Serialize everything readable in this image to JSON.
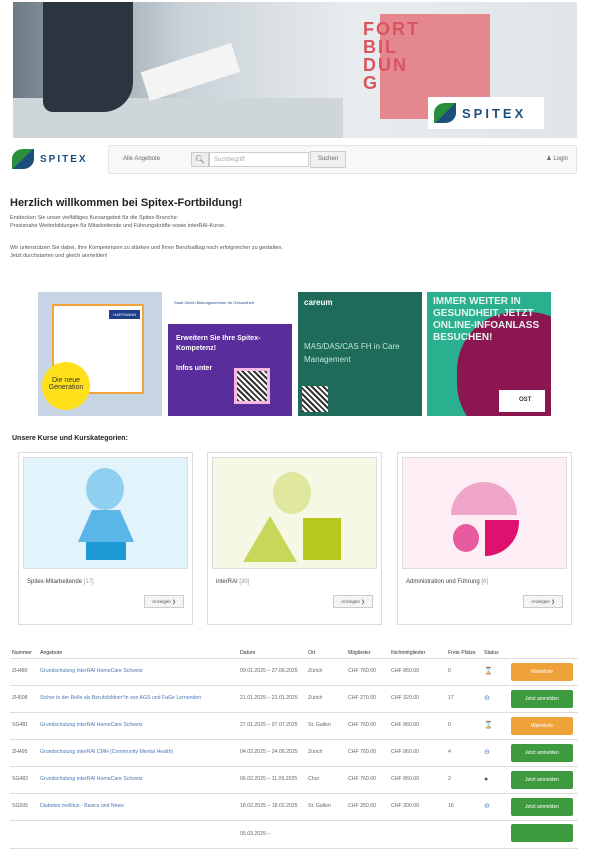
{
  "banner": {
    "text": "FORT\nBIL\nDUN\nG",
    "logo": "SPITEX"
  },
  "header": {
    "logo": "SPITEX",
    "all_offers": "Alle Angebote",
    "search_placeholder": "Suchbegriff",
    "search_button": "Suchen",
    "login": "Login"
  },
  "welcome": {
    "title": "Herzlich willkommen bei Spitex-Fortbildung!",
    "p1": "Entdecken Sie unser vielfältiges Kursangebot für die Spitex-Branche:",
    "p2": "Praxisnahe Weiterbildungen für Mitarbeitende und Führungskräfte sowie interRAI-Kurse.",
    "p3": "Wir unterstützen Sie dabei, Ihre Kompetenzen zu stärken und Ihren Berufsalltag noch erfolgreicher zu gestalten.",
    "p4": "Jetzt durchstarten und gleich anmelden!"
  },
  "ads": [
    {
      "badge": "Die neue Generation",
      "brand": "HARTMANN"
    },
    {
      "header": "Stadt Zürich Bildungszentrum für Gesundheit",
      "text": "Erweitern Sie Ihre Spitex-Kompetenz!",
      "sub": "Infos unter"
    },
    {
      "brand": "careum",
      "text": "MAS/DAS/CAS FH in Care Management"
    },
    {
      "text": "IMMER WEITER IN GESUNDHEIT, JETZT ONLINE-INFOANLASS BESUCHEN!",
      "brand": "OST"
    }
  ],
  "categories": {
    "title": "Unsere Kurse und Kurskategorien:",
    "items": [
      {
        "name": "Spitex-Mitarbeitende",
        "count": "[17]",
        "button": "Anzeigen"
      },
      {
        "name": "interRAI",
        "count": "[30]",
        "button": "Anzeigen"
      },
      {
        "name": "Administration und Führung",
        "count": "[6]",
        "button": "Anzeigen"
      }
    ]
  },
  "table": {
    "headers": [
      "Nummer",
      "Angebote",
      "Datum",
      "Ort",
      "Mitglieder",
      "Nichtmitglieder",
      "Freie Plätze",
      "Status",
      ""
    ],
    "rows": [
      {
        "nr": "ZH480",
        "title": "Grundschulung interRAI HomeCare Schweiz",
        "date": "09.01.2025 – 27.06.2025",
        "ort": "Zürich",
        "mit": "CHF 760.00",
        "nicht": "CHF 860.00",
        "plaetze": "0",
        "status": "⌛",
        "button": "Warteliste",
        "type": "wait"
      },
      {
        "nr": "ZH508",
        "title": "Sicher in der Rolle als Berufsbildner*in von AGS und FaGe Lernenden",
        "date": "21.01.2025 – 21.01.2025",
        "ort": "Zürich",
        "mit": "CHF 270.00",
        "nicht": "CHF 320.00",
        "plaetze": "17",
        "status": "⊖",
        "button": "Jetzt anmelden",
        "type": "reg"
      },
      {
        "nr": "SG481",
        "title": "Grundschulung interRAI HomeCare Schweiz",
        "date": "27.01.2025 – 07.07.2025",
        "ort": "St. Gallen",
        "mit": "CHF 760.00",
        "nicht": "CHF 860.00",
        "plaetze": "0",
        "status": "⌛",
        "button": "Warteliste",
        "type": "wait"
      },
      {
        "nr": "ZH495",
        "title": "Grundschulung interRAI CMH (Community Mental Health)",
        "date": "04.02.2025 – 24.06.2025",
        "ort": "Zürich",
        "mit": "CHF 760.00",
        "nicht": "CHF 860.00",
        "plaetze": "4",
        "status": "⊖",
        "button": "Jetzt anmelden",
        "type": "reg"
      },
      {
        "nr": "SG482",
        "title": "Grundschulung interRAI HomeCare Schweiz",
        "date": "06.02.2025 – 11.09.2025",
        "ort": "Chur",
        "mit": "CHF 760.00",
        "nicht": "CHF 860.00",
        "plaetze": "2",
        "status": "●",
        "button": "Jetzt anmelden",
        "type": "reg"
      },
      {
        "nr": "SG505",
        "title": "Diabetes mellitus - Basics und News",
        "date": "18.02.2025 – 18.02.2025",
        "ort": "St. Gallen",
        "mit": "CHF 250.00",
        "nicht": "CHF 300.00",
        "plaetze": "16",
        "status": "⊖",
        "button": "Jetzt anmelden",
        "type": "reg"
      },
      {
        "nr": "",
        "title": "",
        "date": "05.03.2025 –",
        "ort": "",
        "mit": "",
        "nicht": "",
        "plaetze": "",
        "status": "",
        "button": "",
        "type": "reg"
      }
    ]
  }
}
